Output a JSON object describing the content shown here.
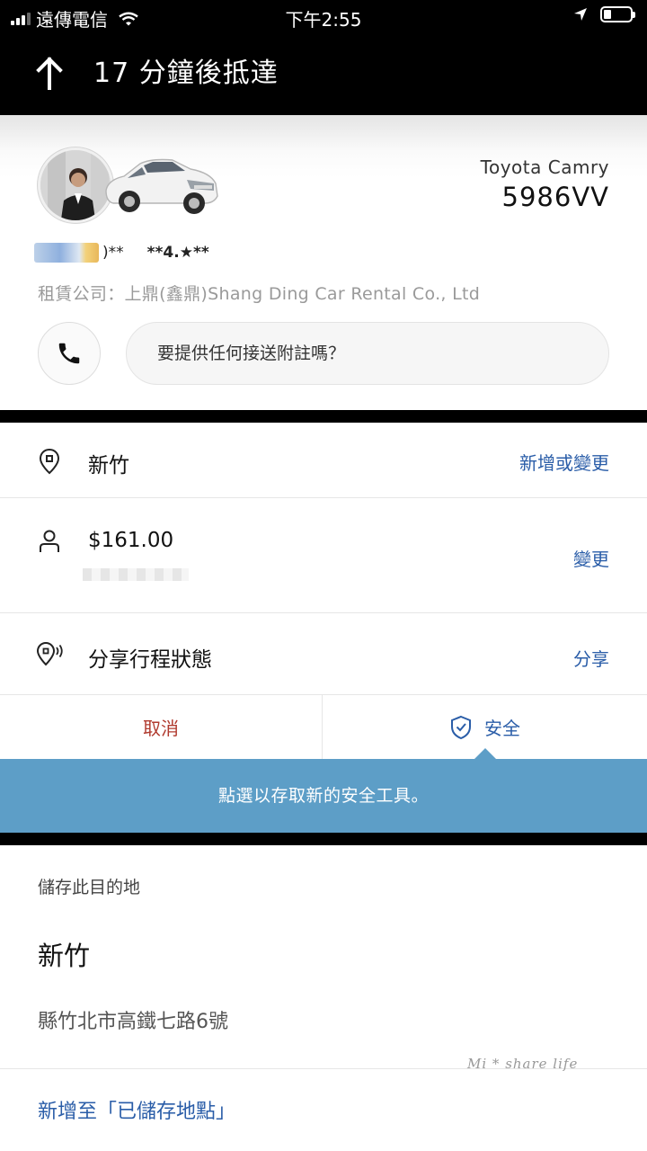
{
  "status_bar": {
    "carrier": "遠傳電信",
    "time": "下午2:55"
  },
  "header": {
    "title": "17 分鐘後抵達",
    "back_icon": "arrow-up-icon"
  },
  "driver": {
    "car_model": "Toyota Camry",
    "plate": "5986VV",
    "name_suffix": ")**",
    "rating": "**4.★**",
    "company": "租賃公司：上鼎(鑫鼎)Shang Ding Car Rental Co., Ltd",
    "note_prompt": "要提供任何接送附註嗎？"
  },
  "destination": {
    "label": "新竹",
    "action": "新增或變更",
    "icon": "location-pin-icon"
  },
  "payment": {
    "amount": "$161.00",
    "action": "變更",
    "icon": "person-icon"
  },
  "share": {
    "label": "分享行程狀態",
    "action": "分享",
    "icon": "location-share-icon"
  },
  "actions": {
    "cancel": "取消",
    "safety": "安全"
  },
  "tooltip": {
    "text": "點選以存取新的安全工具。"
  },
  "save": {
    "title": "儲存此目的地",
    "place": "新竹",
    "address": "縣竹北市高鐵七路6號",
    "add_label": "新增至「已儲存地點」"
  },
  "watermark": "Mi * share life",
  "colors": {
    "accent_blue": "#2a5da8",
    "cancel_red": "#b03a2e",
    "tooltip_bg": "#5d9ec7"
  }
}
